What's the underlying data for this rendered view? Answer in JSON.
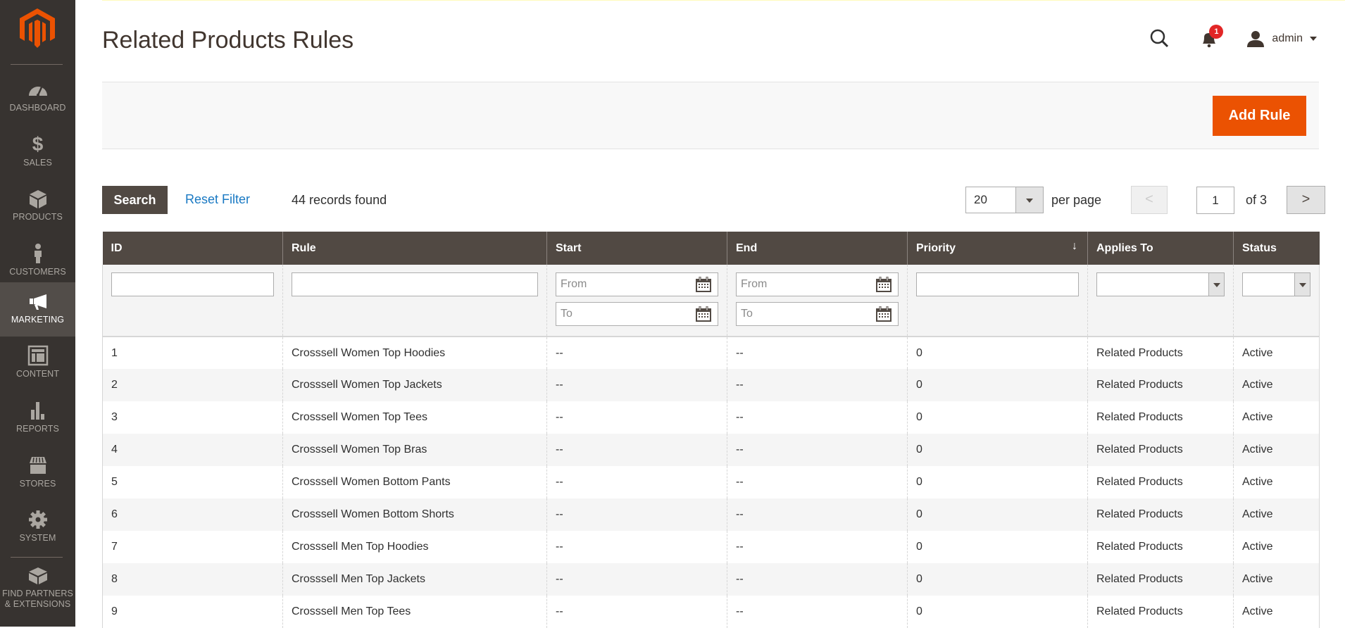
{
  "sidebar": {
    "logo": "magento-logo",
    "items": [
      {
        "label": "DASHBOARD",
        "icon": "dashboard-icon",
        "active": false
      },
      {
        "label": "SALES",
        "icon": "dollar-icon",
        "active": false
      },
      {
        "label": "PRODUCTS",
        "icon": "box-icon",
        "active": false
      },
      {
        "label": "CUSTOMERS",
        "icon": "person-icon",
        "active": false
      },
      {
        "label": "MARKETING",
        "icon": "megaphone-icon",
        "active": true
      },
      {
        "label": "CONTENT",
        "icon": "layout-icon",
        "active": false
      },
      {
        "label": "REPORTS",
        "icon": "bar-chart-icon",
        "active": false
      },
      {
        "label": "STORES",
        "icon": "storefront-icon",
        "active": false
      },
      {
        "label": "SYSTEM",
        "icon": "gear-icon",
        "active": false
      },
      {
        "label": "FIND PARTNERS & EXTENSIONS",
        "icon": "lego-block-icon",
        "active": false
      }
    ]
  },
  "header": {
    "title": "Related Products Rules",
    "notifications_count": "1",
    "user_name": "admin"
  },
  "actions": {
    "add_rule_label": "Add Rule",
    "accent_color": "#eb5202"
  },
  "toolbar": {
    "search_label": "Search",
    "reset_label": "Reset Filter",
    "records_text": "44 records found",
    "per_page_value": "20",
    "per_page_label": "per page",
    "prev_label": "<",
    "current_page": "1",
    "of_pages": "of 3",
    "next_label": ">"
  },
  "grid": {
    "columns": [
      "ID",
      "Rule",
      "Start",
      "End",
      "Priority",
      "Applies To",
      "Status"
    ],
    "sorted_column": "Priority",
    "sort_indicator": "↓",
    "filters": {
      "from_placeholder": "From",
      "to_placeholder": "To"
    },
    "rows": [
      {
        "id": "1",
        "rule": "Crosssell Women Top Hoodies",
        "start": "--",
        "end": "--",
        "priority": "0",
        "applies_to": "Related Products",
        "status": "Active"
      },
      {
        "id": "2",
        "rule": "Crosssell Women Top Jackets",
        "start": "--",
        "end": "--",
        "priority": "0",
        "applies_to": "Related Products",
        "status": "Active"
      },
      {
        "id": "3",
        "rule": "Crosssell Women Top Tees",
        "start": "--",
        "end": "--",
        "priority": "0",
        "applies_to": "Related Products",
        "status": "Active"
      },
      {
        "id": "4",
        "rule": "Crosssell Women Top Bras",
        "start": "--",
        "end": "--",
        "priority": "0",
        "applies_to": "Related Products",
        "status": "Active"
      },
      {
        "id": "5",
        "rule": "Crosssell Women Bottom Pants",
        "start": "--",
        "end": "--",
        "priority": "0",
        "applies_to": "Related Products",
        "status": "Active"
      },
      {
        "id": "6",
        "rule": "Crosssell Women Bottom Shorts",
        "start": "--",
        "end": "--",
        "priority": "0",
        "applies_to": "Related Products",
        "status": "Active"
      },
      {
        "id": "7",
        "rule": "Crosssell Men Top Hoodies",
        "start": "--",
        "end": "--",
        "priority": "0",
        "applies_to": "Related Products",
        "status": "Active"
      },
      {
        "id": "8",
        "rule": "Crosssell Men Top Jackets",
        "start": "--",
        "end": "--",
        "priority": "0",
        "applies_to": "Related Products",
        "status": "Active"
      },
      {
        "id": "9",
        "rule": "Crosssell Men Top Tees",
        "start": "--",
        "end": "--",
        "priority": "0",
        "applies_to": "Related Products",
        "status": "Active"
      }
    ]
  }
}
